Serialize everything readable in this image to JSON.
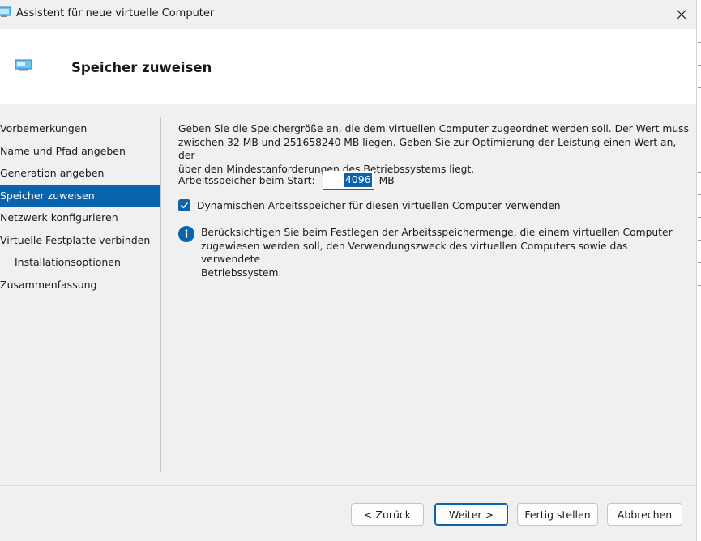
{
  "window": {
    "title": "Assistent für neue virtuelle Computer"
  },
  "header": {
    "title": "Speicher zuweisen"
  },
  "nav": {
    "items": [
      {
        "label": "Vorbemerkungen",
        "active": false
      },
      {
        "label": "Name und Pfad angeben",
        "active": false
      },
      {
        "label": "Generation angeben",
        "active": false
      },
      {
        "label": "Speicher zuweisen",
        "active": true
      },
      {
        "label": "Netzwerk konfigurieren",
        "active": false
      },
      {
        "label": "Virtuelle Festplatte verbinden",
        "active": false
      },
      {
        "label": "Installationsoptionen",
        "active": false,
        "sub": true
      },
      {
        "label": "Zusammenfassung",
        "active": false
      }
    ]
  },
  "content": {
    "description_lines": [
      "Geben Sie die Speichergröße an, die dem virtuellen Computer zugeordnet werden soll. Der Wert muss",
      "zwischen 32 MB und 251658240 MB liegen. Geben Sie zur Optimierung der Leistung einen Wert an, der",
      "über den Mindestanforderungen des Betriebssystems liegt."
    ],
    "ram_label": "Arbeitsspeicher beim Start:",
    "ram_value": "4096",
    "ram_unit": "MB",
    "dynamic_memory_label": "Dynamischen Arbeitsspeicher für diesen virtuellen Computer verwenden",
    "dynamic_memory_checked": true,
    "info_lines": [
      "Berücksichtigen Sie beim Festlegen der Arbeitsspeichermenge, die einem virtuellen Computer",
      "zugewiesen werden soll, den Verwendungszweck des virtuellen Computers sowie das verwendete",
      "Betriebssystem."
    ]
  },
  "buttons": {
    "back": "< Zurück",
    "next": "Weiter >",
    "finish": "Fertig stellen",
    "cancel": "Abbrechen"
  },
  "colors": {
    "accent": "#0a64ad",
    "window_bg": "#f0f0f0",
    "header_bg": "#ffffff"
  },
  "icons": {
    "app": "vm-monitor-icon",
    "close": "close-icon",
    "info": "info-icon",
    "check": "checkmark-icon"
  }
}
